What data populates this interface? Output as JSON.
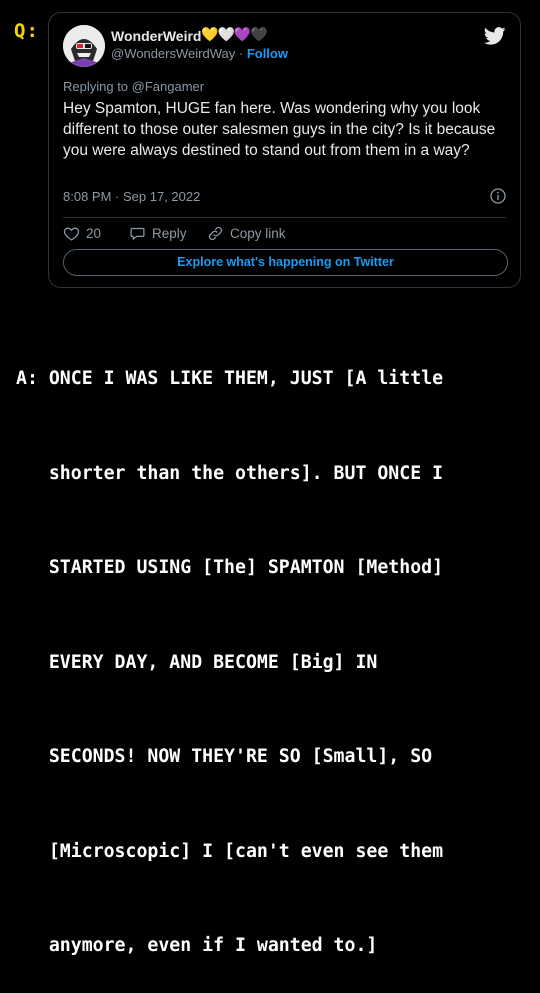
{
  "question_label": "Q:",
  "tweet": {
    "author_name": "WonderWeird",
    "hearts": [
      "💛",
      "🤍",
      "💜",
      "🖤"
    ],
    "handle": "@WondersWeirdWay",
    "separator": "·",
    "follow_label": "Follow",
    "replying_to": "Replying to @Fangamer",
    "text": "Hey Spamton, HUGE fan here. Was wondering why you look different to those outer salesmen guys in the city? Is it because you were always destined to stand out from them in a way?",
    "timestamp": "8:08 PM · Sep 17, 2022",
    "likes": "20",
    "reply_label": "Reply",
    "copy_link_label": "Copy link",
    "explore_label": "Explore what's happening on Twitter",
    "icons": {
      "brand": "twitter-bird-icon",
      "like": "heart-outline-icon",
      "reply": "speech-bubble-icon",
      "copy": "link-icon",
      "info": "info-icon"
    }
  },
  "answer": {
    "lines": [
      "A: ONCE I WAS LIKE THEM, JUST [A little",
      "   shorter than the others]. BUT ONCE I",
      "   STARTED USING [The] SPAMTON [Method]",
      "   EVERY DAY, AND BECOME [Big] IN",
      "   SECONDS! NOW THEY'RE SO [Small], SO",
      "   [Microscopic] I [can't even see them",
      "   anymore, even if I wanted to.]"
    ]
  },
  "colors": {
    "background": "#000000",
    "label_yellow": "#f5d40f",
    "link_blue": "#1d9bf0",
    "muted_gray": "#8b98a5",
    "border": "#2f3336"
  }
}
